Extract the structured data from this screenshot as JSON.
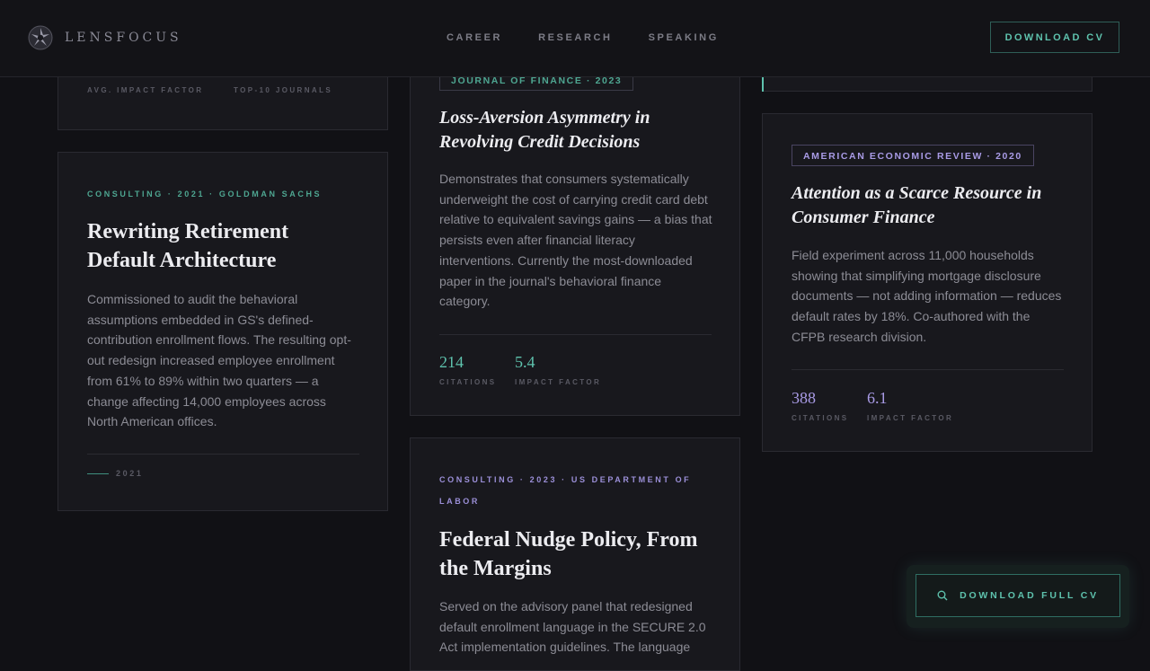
{
  "brand": {
    "name": "LENSFOCUS"
  },
  "nav": {
    "items": [
      "CAREER",
      "RESEARCH",
      "SPEAKING"
    ]
  },
  "header": {
    "download_cv": "DOWNLOAD CV"
  },
  "top_stats": {
    "avg_impact_label": "AVG. IMPACT FACTOR",
    "top_journals_label": "TOP-10 JOURNALS"
  },
  "goldman": {
    "eyebrow": "CONSULTING · 2021 · GOLDMAN SACHS",
    "title": "Rewriting Retirement Default Architecture",
    "body": "Commissioned to audit the behavioral assumptions embedded in GS's defined-contribution enrollment flows. The resulting opt-out redesign increased employee enrollment from 61% to 89% within two quarters — a change affecting 14,000 employees across North American offices.",
    "year": "2021"
  },
  "loss_aversion": {
    "tag": "JOURNAL OF FINANCE · 2023",
    "title": "Loss-Aversion Asymmetry in Revolving Credit Decisions",
    "body": "Demonstrates that consumers systematically underweight the cost of carrying credit card debt relative to equivalent savings gains — a bias that persists even after financial literacy interventions. Currently the most-downloaded paper in the journal's behavioral finance category.",
    "citations": "214",
    "citations_label": "CITATIONS",
    "impact": "5.4",
    "impact_label": "IMPACT FACTOR"
  },
  "nudge": {
    "eyebrow": "CONSULTING · 2023 · US DEPARTMENT OF LABOR",
    "title": "Federal Nudge Policy, From the Margins",
    "body": "Served on the advisory panel that redesigned default enrollment language in the SECURE 2.0 Act implementation guidelines. The language"
  },
  "attention": {
    "tag": "AMERICAN ECONOMIC REVIEW · 2020",
    "title": "Attention as a Scarce Resource in Consumer Finance",
    "body": "Field experiment across 11,000 households showing that simplifying mortgage disclosure documents — not adding information — reduces default rates by 18%. Co-authored with the CFPB research division.",
    "citations": "388",
    "citations_label": "CITATIONS",
    "impact": "6.1",
    "impact_label": "IMPACT FACTOR"
  },
  "floating": {
    "label": "DOWNLOAD FULL CV",
    "icon": "search-icon"
  }
}
